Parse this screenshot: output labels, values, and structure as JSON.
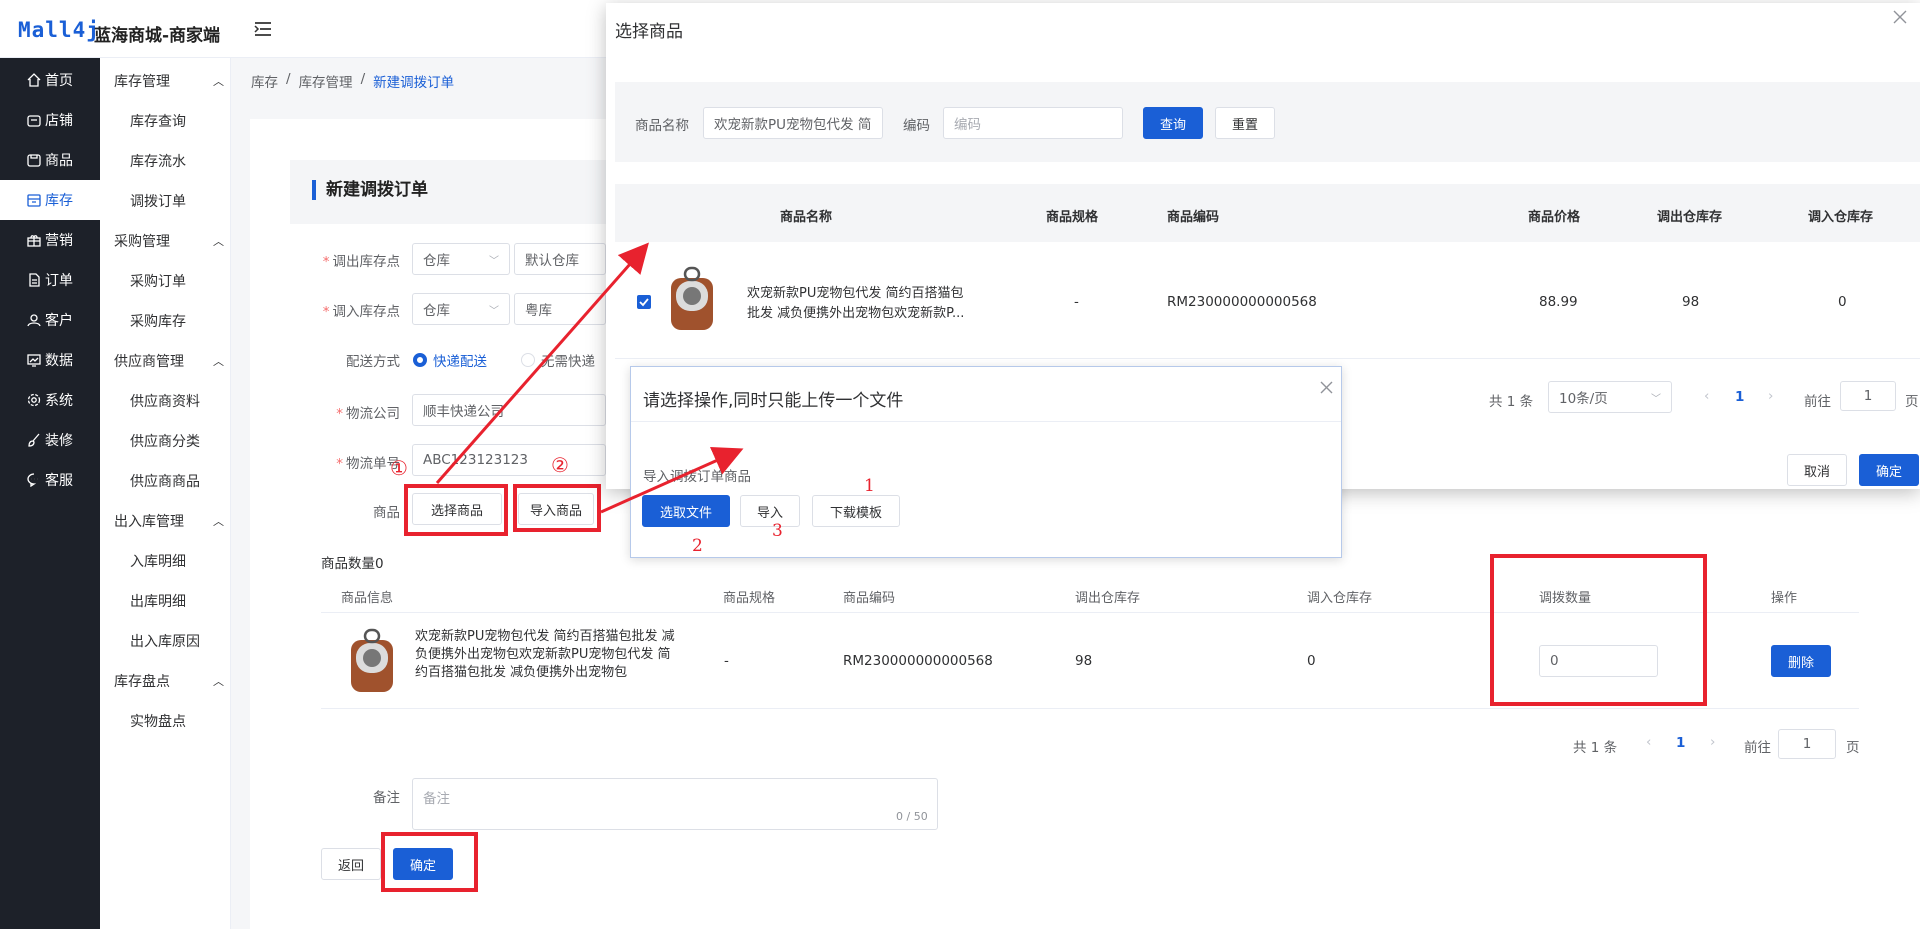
{
  "app": {
    "logo": "Mall4j",
    "title": "蓝海商城-商家端"
  },
  "nav": [
    {
      "label": "首页",
      "icon": "home-icon"
    },
    {
      "label": "店铺",
      "icon": "shop-icon"
    },
    {
      "label": "商品",
      "icon": "goods-icon"
    },
    {
      "label": "库存",
      "icon": "stock-icon"
    },
    {
      "label": "营销",
      "icon": "gift-icon"
    },
    {
      "label": "订单",
      "icon": "order-icon"
    },
    {
      "label": "客户",
      "icon": "user-icon"
    },
    {
      "label": "数据",
      "icon": "chart-icon"
    },
    {
      "label": "系统",
      "icon": "gear-icon"
    },
    {
      "label": "装修",
      "icon": "brush-icon"
    },
    {
      "label": "客服",
      "icon": "chat-icon"
    }
  ],
  "subnav": {
    "groups": [
      {
        "title": "库存管理",
        "items": [
          "库存查询",
          "库存流水",
          "调拨订单"
        ]
      },
      {
        "title": "采购管理",
        "items": [
          "采购订单",
          "采购库存"
        ]
      },
      {
        "title": "供应商管理",
        "items": [
          "供应商资料",
          "供应商分类",
          "供应商商品"
        ]
      },
      {
        "title": "出入库管理",
        "items": [
          "入库明细",
          "出库明细",
          "出入库原因"
        ]
      },
      {
        "title": "库存盘点",
        "items": [
          "实物盘点"
        ]
      }
    ]
  },
  "breadcrumb": [
    "库存",
    "库存管理",
    "新建调拨订单"
  ],
  "form": {
    "title": "新建调拨订单",
    "out_label": "调出库存点",
    "out_type": "仓库",
    "out_value": "默认仓库",
    "in_label": "调入库存点",
    "in_type": "仓库",
    "in_value": "粤库",
    "delivery_label": "配送方式",
    "delivery_opt1": "快递配送",
    "delivery_opt2": "无需快递",
    "company_label": "物流公司",
    "company_value": "顺丰快递公司",
    "tracking_label": "物流单号",
    "tracking_value": "ABC123123123",
    "goods_label": "商品",
    "select_goods": "选择商品",
    "import_goods": "导入商品",
    "count_text": "商品数量0",
    "remark_label": "备注",
    "remark_placeholder": "备注",
    "remark_count": "0 / 50",
    "back": "返回",
    "confirm": "确定"
  },
  "table": {
    "headers": [
      "商品信息",
      "商品规格",
      "商品编码",
      "调出仓库存",
      "调入仓库存",
      "调拨数量",
      "操作"
    ],
    "row": {
      "name1": "欢宠新款PU宠物包代发 简约百搭猫包批发 减",
      "name2": "负便携外出宠物包欢宠新款PU宠物包代发 简",
      "name3": "约百搭猫包批发 减负便携外出宠物包",
      "spec": "-",
      "code": "RM230000000000568",
      "out_stock": "98",
      "in_stock": "0",
      "qty": "0",
      "delete": "删除"
    },
    "pager": {
      "total": "共 1 条",
      "page": "1",
      "goto": "前往",
      "goto_value": "1",
      "page_unit": "页"
    }
  },
  "dialog": {
    "title": "选择商品",
    "name_label": "商品名称",
    "name_value": "欢宠新款PU宠物包代发 简",
    "code_label": "编码",
    "code_placeholder": "编码",
    "query": "查询",
    "reset": "重置",
    "headers": [
      "商品名称",
      "商品规格",
      "商品编码",
      "商品价格",
      "调出仓库存",
      "调入仓库存"
    ],
    "row": {
      "name1": "欢宠新款PU宠物包代发 简约百搭猫包",
      "name2": "批发 减负便携外出宠物包欢宠新款P...",
      "spec": "-",
      "code": "RM230000000000568",
      "price": "88.99",
      "out_stock": "98",
      "in_stock": "0"
    },
    "pager": {
      "total": "共 1 条",
      "size": "10条/页",
      "page": "1",
      "goto": "前往",
      "goto_value": "1",
      "page_unit": "页"
    },
    "cancel": "取消",
    "confirm": "确定"
  },
  "upload": {
    "title": "请选择操作,同时只能上传一个文件",
    "desc": "导入调拨订单商品",
    "choose": "选取文件",
    "import": "导入",
    "download": "下载模板"
  },
  "annotations": {
    "c1": "①",
    "c2": "②",
    "n1": "1",
    "n2": "2",
    "n3": "3"
  },
  "colors": {
    "primary": "#1a5fd6",
    "highlight": "#e8222e",
    "nav_bg": "#1d2129"
  }
}
